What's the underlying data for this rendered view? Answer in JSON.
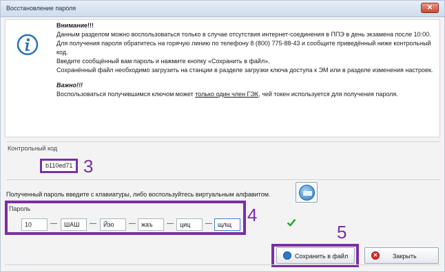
{
  "window": {
    "title": "Восстановление пароля",
    "close_glyph": "✕"
  },
  "warning": {
    "heading": "Внимание!!!",
    "line1": "Данным разделом можно воспользоваться только в случае отсутствия интернет-соединения в ППЭ в день экзамена после 10:00.",
    "line2": "Для получения пароля обратитесь на горячую линию по телефону 8 (800) 775-88-43 и сообщите приведённый ниже контрольный код.",
    "line3": "Введите сообщённый вам пароль и нажмите кнопку «Сохранить в файл».",
    "line4": "Сохранённый файл необходимо загрузить на станции в разделе загрузки ключа доступа к ЭМ или в разделе изменения настроек.",
    "important_heading": "Важно!!!",
    "important_pre": "Воспользоваться получившимся ключом может ",
    "important_underlined": "только один член ГЭК",
    "important_post": ", чей токен используется для получения пароля."
  },
  "control_code": {
    "label": "Контрольный код",
    "value": "b110ed71"
  },
  "annotations": {
    "n3": "3",
    "n4": "4",
    "n5": "5"
  },
  "instruction": "Полученный пароль введите с клавиатуры, либо воспользуйтесь виртуальным алфавитом.",
  "password": {
    "label": "Пароль",
    "separator": "—",
    "fields": [
      "10",
      "ШАШ",
      "Йзо",
      "жаъ",
      "циц",
      "щлщ"
    ]
  },
  "buttons": {
    "save": "Сохранить в файл",
    "close": "Закрыть"
  },
  "colors": {
    "annotation": "#7a2ea8",
    "check": "#2fa82f"
  },
  "icons": {
    "info": "info-icon",
    "keyboard": "virtual-keyboard-icon",
    "check": "check-icon",
    "save": "save-icon",
    "close": "close-icon"
  }
}
